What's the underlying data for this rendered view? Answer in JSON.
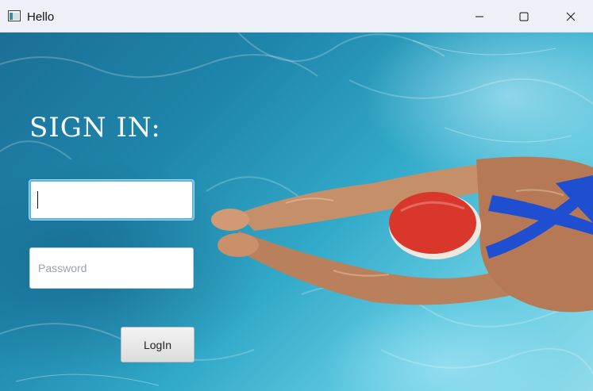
{
  "window": {
    "title": "Hello",
    "icon": "app-window-icon",
    "controls": [
      "minimize-icon",
      "maximize-icon",
      "close-icon"
    ]
  },
  "form": {
    "heading": "SIGN IN:",
    "username": {
      "value": "",
      "placeholder": ""
    },
    "password": {
      "value": "",
      "placeholder": "Password"
    },
    "login_label": "LogIn"
  },
  "colors": {
    "water": "#2a9fc4",
    "cap": "#d9372b",
    "swimsuit": "#1f4fd0",
    "focus_border": "#5ab4e6"
  }
}
